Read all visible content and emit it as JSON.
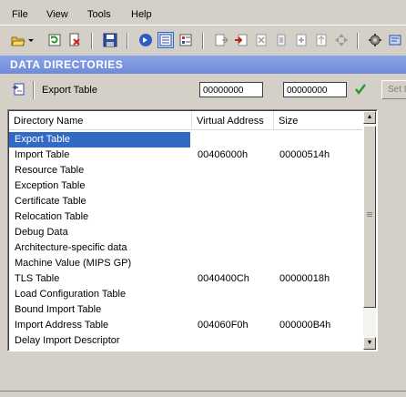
{
  "menu": {
    "file": "File",
    "view": "View",
    "tools": "Tools",
    "help": "Help"
  },
  "toolbar": {
    "icons": [
      "open-icon",
      "dropdown-arrow-icon",
      "refresh-icon",
      "close-file-icon",
      "save-icon",
      "view-headers-icon",
      "view-list-icon",
      "view-details-icon",
      "export-icon",
      "import-icon",
      "delete-icon",
      "compress-icon",
      "add-section-icon",
      "move-up-icon",
      "move-nav-icon",
      "settings-icon",
      "help-icon"
    ]
  },
  "section": {
    "title": "DATA DIRECTORIES"
  },
  "properties": {
    "selected_name": "Export Table",
    "virtual_address": "00000000",
    "size": "00000000",
    "set_label": "Set I"
  },
  "table": {
    "columns": [
      "Directory Name",
      "Virtual Address",
      "Size"
    ],
    "rows": [
      {
        "name": "Export Table",
        "va": "",
        "size": ""
      },
      {
        "name": "Import Table",
        "va": "00406000h",
        "size": "00000514h"
      },
      {
        "name": "Resource Table",
        "va": "",
        "size": ""
      },
      {
        "name": "Exception Table",
        "va": "",
        "size": ""
      },
      {
        "name": "Certificate Table",
        "va": "",
        "size": ""
      },
      {
        "name": "Relocation Table",
        "va": "",
        "size": ""
      },
      {
        "name": "Debug Data",
        "va": "",
        "size": ""
      },
      {
        "name": "Architecture-specific data",
        "va": "",
        "size": ""
      },
      {
        "name": "Machine Value (MIPS GP)",
        "va": "",
        "size": ""
      },
      {
        "name": "TLS Table",
        "va": "0040400Ch",
        "size": "00000018h"
      },
      {
        "name": "Load Configuration Table",
        "va": "",
        "size": ""
      },
      {
        "name": "Bound Import Table",
        "va": "",
        "size": ""
      },
      {
        "name": "Import Address Table",
        "va": "004060F0h",
        "size": "000000B4h"
      },
      {
        "name": "Delay Import Descriptor",
        "va": "",
        "size": ""
      }
    ]
  },
  "colors": {
    "section_bg": "#7a96df",
    "selection": "#316ac5",
    "check_green": "#2a9a2a"
  }
}
